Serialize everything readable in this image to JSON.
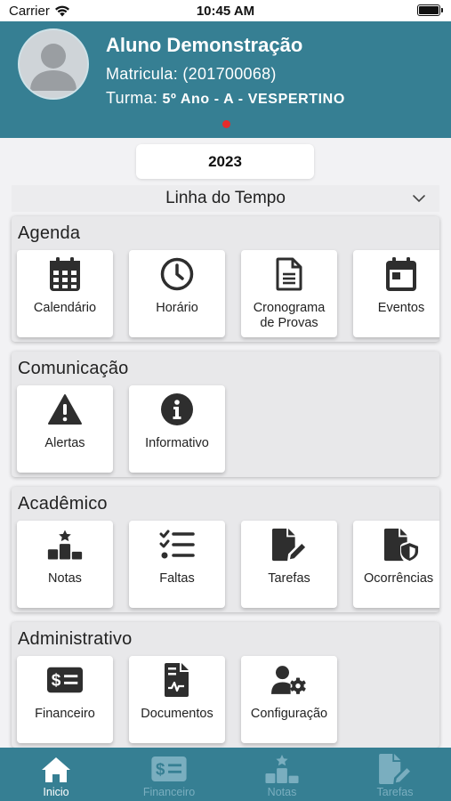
{
  "status_bar": {
    "carrier": "Carrier",
    "time": "10:45 AM"
  },
  "header": {
    "name": "Aluno Demonstração",
    "matricula_label": "Matricula:",
    "matricula_value": "(201700068)",
    "turma_label": "Turma:",
    "turma_value": "5º Ano - A - VESPERTINO"
  },
  "year": "2023",
  "timeline": {
    "label": "Linha do Tempo"
  },
  "sections": {
    "agenda": {
      "title": "Agenda",
      "items": [
        "Calendário",
        "Horário",
        "Cronograma\nde Provas",
        "Eventos"
      ]
    },
    "comunicacao": {
      "title": "Comunicação",
      "items": [
        "Alertas",
        "Informativo"
      ]
    },
    "academico": {
      "title": "Acadêmico",
      "items": [
        "Notas",
        "Faltas",
        "Tarefas",
        "Ocorrências"
      ]
    },
    "administrativo": {
      "title": "Administrativo",
      "items": [
        "Financeiro",
        "Documentos",
        "Configuração"
      ]
    }
  },
  "tabbar": {
    "tabs": [
      "Inicio",
      "Financeiro",
      "Notas",
      "Tarefas"
    ],
    "active": "Inicio"
  },
  "colors": {
    "brand": "#367f93",
    "accent_dot": "#e52b2b",
    "tab_inactive": "#7aaebf"
  },
  "icons": {
    "agenda": [
      "calendar-grid-icon",
      "clock-icon",
      "document-lines-icon",
      "calendar-event-icon"
    ],
    "comunicacao": [
      "warning-icon",
      "info-icon"
    ],
    "academico": [
      "podium-icon",
      "checklist-icon",
      "file-pen-icon",
      "file-shield-icon"
    ],
    "administrativo": [
      "money-bill-icon",
      "file-chart-icon",
      "user-gear-icon"
    ],
    "tabbar": [
      "home-icon",
      "money-bill-icon",
      "podium-icon",
      "file-pen-icon"
    ]
  }
}
